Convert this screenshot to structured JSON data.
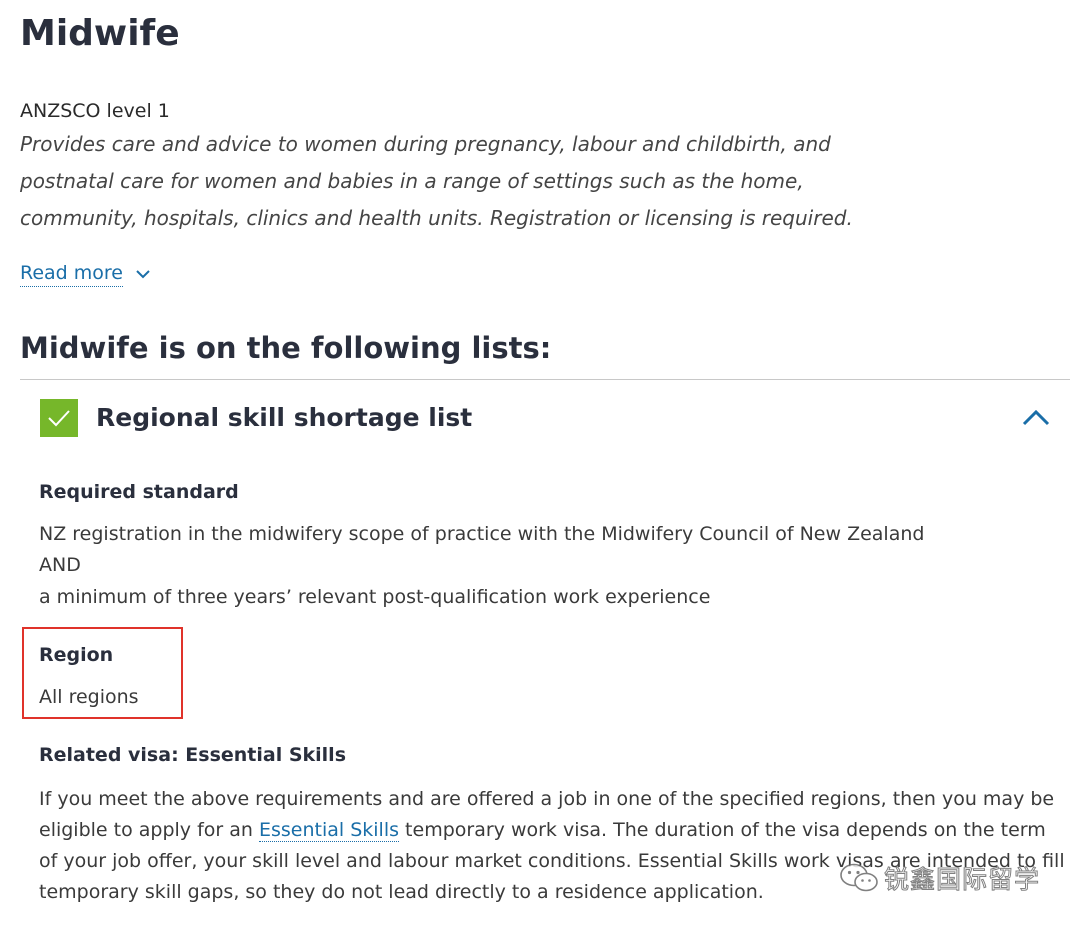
{
  "page": {
    "title": "Midwife",
    "anzsco_level": "ANZSCO level 1",
    "description_lines": [
      "Provides care and advice to women during pregnancy, labour and childbirth, and",
      "postnatal care for women and babies in a range of settings such as the home,",
      "community, hospitals, clinics and health units. Registration or licensing is required."
    ],
    "read_more_label": "Read more",
    "lists_heading": "Midwife is on the following lists:"
  },
  "accordion": {
    "title": "Regional skill shortage list",
    "expanded": true,
    "check_color": "#76b72a",
    "required_standard": {
      "heading": "Required standard",
      "lines": [
        "NZ registration in the midwifery scope of practice with the Midwifery Council of New Zealand",
        "AND",
        "a minimum of three years’ relevant post-qualification work experience"
      ]
    },
    "region": {
      "heading": "Region",
      "value": "All regions",
      "highlight_color": "#e0322a"
    },
    "related_visa": {
      "heading": "Related visa: Essential Skills",
      "before_link": "If you meet the above requirements and are offered a job in one of the specified regions, then you may be eligible to apply for an ",
      "link_text": "Essential Skills",
      "after_link": " temporary work visa. The duration of the visa depends on the term of your job offer, your skill level and labour market conditions. Essential Skills work visas are intended to fill temporary skill gaps, so they do not lead directly to a residence application."
    }
  },
  "watermark": {
    "text": "锐鑫国际留学",
    "icon": "wechat-icon"
  },
  "colors": {
    "link": "#1a6ea8",
    "heading": "#2a2f3d",
    "check_green": "#76b72a"
  }
}
